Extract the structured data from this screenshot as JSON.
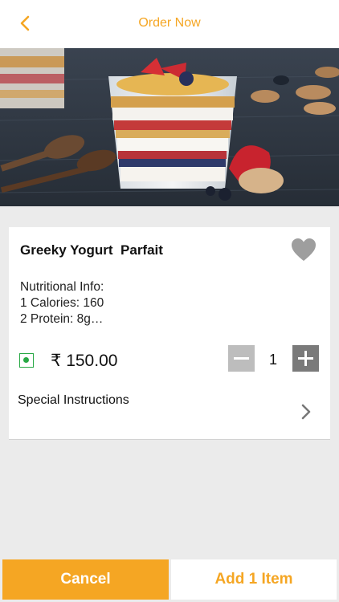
{
  "header": {
    "title": "Order Now",
    "back_icon": "chevron-left-icon"
  },
  "item": {
    "name": "Greeky Yogurt  Parfait",
    "nutrition_title": "Nutritional Info:",
    "nutrition_lines": [
      "1 Calories: 160",
      "2 Protein: 8g…"
    ],
    "price": "₹ 150.00",
    "quantity": "1",
    "favorite_icon": "heart-icon",
    "veg_icon": "veg-indicator-icon"
  },
  "special_instructions": {
    "label": "Special Instructions",
    "icon": "chevron-right-icon"
  },
  "footer": {
    "cancel_label": "Cancel",
    "add_label": "Add 1 Item"
  },
  "colors": {
    "accent": "#f5a623",
    "veg": "#27a844",
    "background": "#ebebeb"
  }
}
